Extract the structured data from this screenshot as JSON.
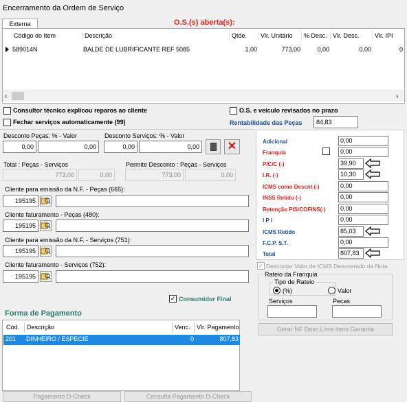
{
  "window": {
    "title": "Encerramento da Ordem de Serviço"
  },
  "tabs": [
    {
      "label": "Externa"
    }
  ],
  "os_title": "O.S.(s) aberta(s):",
  "items_table": {
    "headers": [
      "Código do Item",
      "Descrição",
      "Qtde.",
      "Vlr. Unitário",
      "% Desc.",
      "Vlr. Desc.",
      "Vlr. IPI"
    ],
    "rows": [
      {
        "codigo": "589014N",
        "descricao": "BALDE DE LUBRIFICANTE REF 5085",
        "qtde": "1,00",
        "vlr_unitario": "773,00",
        "desc_pct": "0,00",
        "vlr_desc": "0,00",
        "vlr_ipi": "0"
      }
    ]
  },
  "checks": {
    "consultor": "Consultor técnico explicou reparos ao cliente",
    "os_revisados": "O.S. e veículo revisados no prazo",
    "fechar": "Fechar serviços automaticamente (99)",
    "rentabilidade_label": "Rentabilidade das Peças",
    "rentabilidade_value": "84,83"
  },
  "desconto": {
    "pecas_label": "Desconto Peças: % - Valor",
    "pecas_pct": "0,00",
    "pecas_val": "0,00",
    "servicos_label": "Desconto Serviços: % - Valor",
    "serv_pct": "0,00",
    "serv_val": "0,00"
  },
  "totais": {
    "total_label": "Total : Peças - Serviços",
    "total_pecas": "773,00",
    "total_serv": "0,00",
    "permite_label": "Permite Desconto : Peças - Serviços",
    "permite_pecas": "773,00",
    "permite_serv": "0,00"
  },
  "clientes": [
    {
      "label": "Cliente para emissão da N.F. - Peças (665):",
      "code": "195195",
      "name": ""
    },
    {
      "label": "Cliente faturamento - Peças (480):",
      "code": "195195",
      "name": ""
    },
    {
      "label": "Cliente para emissão da N.F. - Serviços (751):",
      "code": "195195",
      "name": ""
    },
    {
      "label": "Cliente faturamento - Serviços (752):",
      "code": "195195",
      "name": ""
    }
  ],
  "consumidor_final": "Consumidor Final",
  "right_panel": [
    {
      "label": "Adicional",
      "value": "0,00",
      "color": "blue"
    },
    {
      "label": "Franquia",
      "value": "0,00",
      "color": "red"
    },
    {
      "label": "P/C/C (-)",
      "value": "39,90",
      "color": "red"
    },
    {
      "label": "I.R. (-)",
      "value": "10,30",
      "color": "red"
    },
    {
      "label": "ICMS como Descnt.(-)",
      "value": "0,00",
      "color": "red"
    },
    {
      "label": "INSS Retido (-)",
      "value": "0,00",
      "color": "red"
    },
    {
      "label": "Retenção PIS/COFINS(-)",
      "value": "0,00",
      "color": "red"
    },
    {
      "label": "I P I",
      "value": "0,00",
      "color": "blue"
    },
    {
      "label": "ICMS Retido",
      "value": "85,03",
      "color": "blue"
    },
    {
      "label": "F.C.P. S.T.",
      "value": "0,00",
      "color": "blue"
    },
    {
      "label": "Total",
      "value": "807,83",
      "color": "blue"
    }
  ],
  "descontar_icms": "Descontar Valor de ICMS Desonerado da Nota.",
  "rateio": {
    "title": "Rateio da Franquia",
    "tipo_label": "Tipo de Rateio",
    "opt_pct": "(%)",
    "opt_valor": "Valor",
    "servicos": "Serviços",
    "pecas": "Pecas"
  },
  "gerar_nf": "Gerar NF Desc.Livre Itens Garantia",
  "pagamento": {
    "title": "Forma de Pagamento",
    "headers": [
      "Cód.",
      "Descrição",
      "Venc.",
      "Vlr. Pagamento"
    ],
    "rows": [
      {
        "cod": "201",
        "descricao": "DINHEIRO / ESPECIE",
        "venc": "0",
        "valor": "807,83"
      }
    ]
  },
  "bottom_buttons": {
    "d_check": "Pagamento D-Check",
    "consulta": "Consulta Pagamento D-Check"
  },
  "colors": {
    "red": "#e0201b",
    "blue": "#1f4fa0",
    "green": "#2a7a6b",
    "selection": "#1e88e5"
  }
}
